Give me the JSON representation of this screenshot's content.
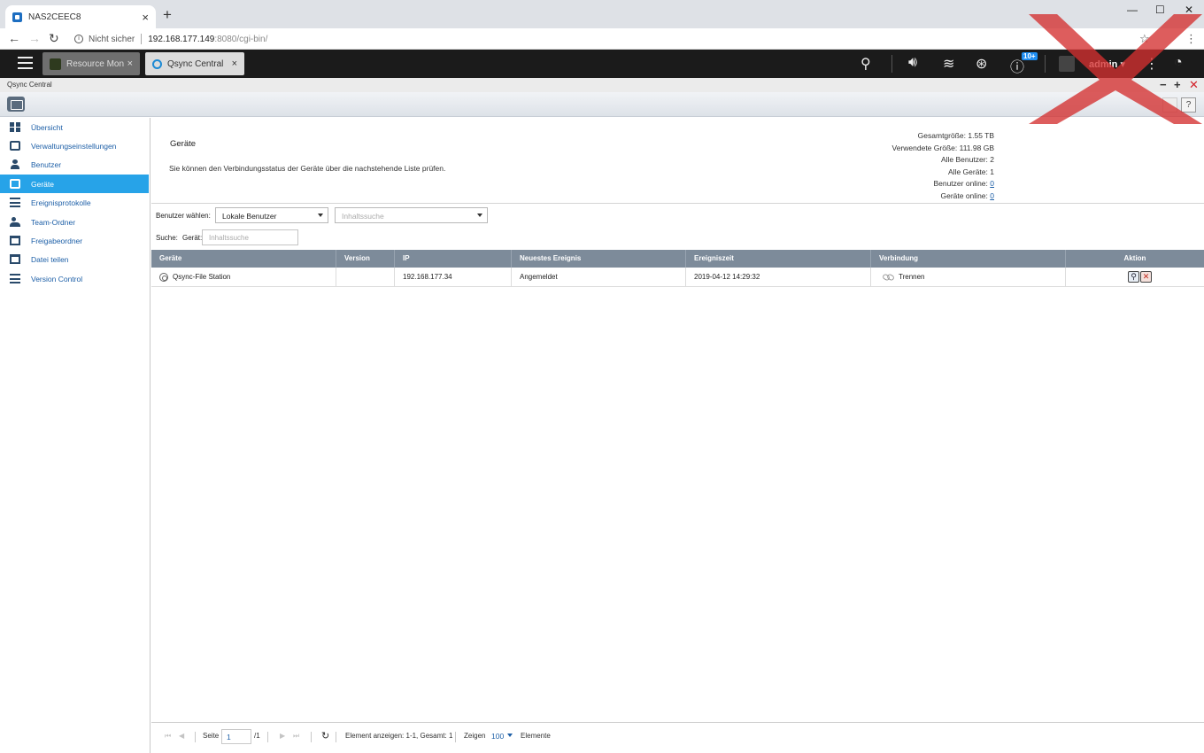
{
  "browser": {
    "tab_title": "NAS2CEEC8",
    "new_tab": "+",
    "close": "×",
    "insecure_label": "Nicht sicher",
    "url_host": "192.168.177.149",
    "url_path": ":8080/cgi-bin/",
    "controls": {
      "minimize": "—",
      "maximize": "☐",
      "close": "✕"
    }
  },
  "qts": {
    "tabs": [
      {
        "label": "Resource Monit...",
        "close": "×"
      },
      {
        "label": "Qsync Central",
        "close": "×"
      }
    ],
    "badge": "10+",
    "user": "admin ▾"
  },
  "window": {
    "title": "Qsync Central",
    "help": "?",
    "buttons": {
      "minimize": "−",
      "maximize": "+",
      "close": "✕"
    }
  },
  "sidebar": {
    "items": [
      {
        "label": "Übersicht",
        "icon": "overview-icon"
      },
      {
        "label": "Verwaltungseinstellungen",
        "icon": "settings-icon"
      },
      {
        "label": "Benutzer",
        "icon": "user-icon"
      },
      {
        "label": "Geräte",
        "icon": "device-icon",
        "active": true
      },
      {
        "label": "Ereignisprotokolle",
        "icon": "event-log-icon"
      },
      {
        "label": "Team-Ordner",
        "icon": "team-folder-icon"
      },
      {
        "label": "Freigabeordner",
        "icon": "shared-folder-icon"
      },
      {
        "label": "Datei teilen",
        "icon": "file-share-icon"
      },
      {
        "label": "Version Control",
        "icon": "version-control-icon"
      }
    ]
  },
  "main": {
    "title": "Geräte",
    "description": "Sie können den Verbindungsstatus der Geräte über die nachstehende Liste prüfen.",
    "stats": {
      "total_size_label": "Gesamtgröße:",
      "total_size": "1.55 TB",
      "used_size_label": "Verwendete Größe:",
      "used_size": "111.98 GB",
      "all_users_label": "Alle Benutzer:",
      "all_users": "2",
      "all_devices_label": "Alle Geräte:",
      "all_devices": "1",
      "users_online_label": "Benutzer online:",
      "users_online": "0",
      "devices_online_label": "Geräte online:",
      "devices_online": "0"
    },
    "filter": {
      "user_select_label": "Benutzer wählen:",
      "user_select_value": "Lokale Benutzer",
      "content_search_placeholder": "Inhaltssuche",
      "search_label": "Suche:",
      "device_label": "Gerät:",
      "device_search_placeholder": "Inhaltssuche"
    },
    "table": {
      "columns": [
        "Geräte",
        "Version",
        "IP",
        "Neuestes Ereignis",
        "Ereigniszeit",
        "Verbindung",
        "Aktion"
      ],
      "rows": [
        {
          "device": "Qsync-File Station",
          "version": "",
          "ip": "192.168.177.34",
          "event": "Angemeldet",
          "time": "2019-04-12 14:29:32",
          "connection": "Trennen"
        }
      ]
    },
    "pager": {
      "page_label": "Seite",
      "page_value": "1",
      "page_total": "/1",
      "display_info": "Element anzeigen: 1-1, Gesamt: 1",
      "show_label": "Zeigen",
      "show_value": "100",
      "items_label": "Elemente"
    }
  },
  "colors": {
    "qts_bar": "#1b1b1b",
    "sidebar_active": "#27a3e8",
    "table_header": "#7d8b9a",
    "link": "#1d5fa7",
    "close_red": "#d3222a"
  }
}
